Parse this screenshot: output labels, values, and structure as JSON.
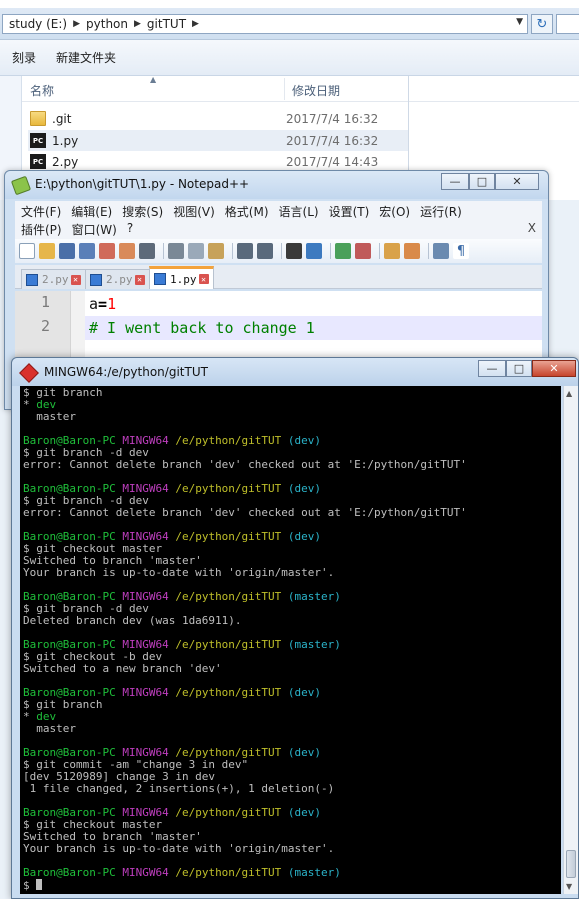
{
  "explorer": {
    "breadcrumbs": [
      "study (E:)",
      "python",
      "gitTUT"
    ],
    "commands": [
      "刻录",
      "新建文件夹"
    ],
    "columns": {
      "name": "名称",
      "date": "修改日期"
    },
    "files": [
      {
        "name": ".git",
        "date": "2017/7/4 16:32",
        "type": "folder"
      },
      {
        "name": "1.py",
        "date": "2017/7/4 16:32",
        "type": "py"
      },
      {
        "name": "2.py",
        "date": "2017/7/4 14:43",
        "type": "py"
      }
    ]
  },
  "notepad": {
    "title": "E:\\python\\gitTUT\\1.py - Notepad++",
    "menu_row1": [
      "文件(F)",
      "编辑(E)",
      "搜索(S)",
      "视图(V)",
      "格式(M)",
      "语言(L)",
      "设置(T)",
      "宏(O)",
      "运行(R)"
    ],
    "menu_row2": [
      "插件(P)",
      "窗口(W)",
      "?"
    ],
    "menu_close": "X",
    "tabs": [
      {
        "label": "2.py",
        "active": false
      },
      {
        "label": "2.py",
        "active": false
      },
      {
        "label": "1.py",
        "active": true
      }
    ],
    "line_numbers": [
      "1",
      "2"
    ],
    "code": {
      "line1": {
        "ident": "a",
        "op": "=",
        "num": "1"
      },
      "line2": {
        "comment": "# I went back to change 1"
      }
    }
  },
  "terminal": {
    "title": "MINGW64:/e/python/gitTUT",
    "colors": {
      "green": "#1fbf3a",
      "magenta": "#bf3fbf",
      "yellow": "#bfbf2a",
      "cyan": "#2bb3c9"
    },
    "lines": [
      [
        {
          "t": "$ git branch"
        }
      ],
      [
        {
          "t": "* "
        },
        {
          "t": "dev",
          "c": "green"
        }
      ],
      [
        {
          "t": "  master"
        }
      ],
      [
        {
          "t": ""
        }
      ],
      [
        {
          "t": "Baron@Baron-PC ",
          "c": "green"
        },
        {
          "t": "MINGW64 ",
          "c": "magenta"
        },
        {
          "t": "/e/python/gitTUT ",
          "c": "yellow"
        },
        {
          "t": "(dev)",
          "c": "cyan"
        }
      ],
      [
        {
          "t": "$ git branch -d dev"
        }
      ],
      [
        {
          "t": "error: Cannot delete branch 'dev' checked out at 'E:/python/gitTUT'"
        }
      ],
      [
        {
          "t": ""
        }
      ],
      [
        {
          "t": "Baron@Baron-PC ",
          "c": "green"
        },
        {
          "t": "MINGW64 ",
          "c": "magenta"
        },
        {
          "t": "/e/python/gitTUT ",
          "c": "yellow"
        },
        {
          "t": "(dev)",
          "c": "cyan"
        }
      ],
      [
        {
          "t": "$ git branch -d dev"
        }
      ],
      [
        {
          "t": "error: Cannot delete branch 'dev' checked out at 'E:/python/gitTUT'"
        }
      ],
      [
        {
          "t": ""
        }
      ],
      [
        {
          "t": "Baron@Baron-PC ",
          "c": "green"
        },
        {
          "t": "MINGW64 ",
          "c": "magenta"
        },
        {
          "t": "/e/python/gitTUT ",
          "c": "yellow"
        },
        {
          "t": "(dev)",
          "c": "cyan"
        }
      ],
      [
        {
          "t": "$ git checkout master"
        }
      ],
      [
        {
          "t": "Switched to branch 'master'"
        }
      ],
      [
        {
          "t": "Your branch is up-to-date with 'origin/master'."
        }
      ],
      [
        {
          "t": ""
        }
      ],
      [
        {
          "t": "Baron@Baron-PC ",
          "c": "green"
        },
        {
          "t": "MINGW64 ",
          "c": "magenta"
        },
        {
          "t": "/e/python/gitTUT ",
          "c": "yellow"
        },
        {
          "t": "(master)",
          "c": "cyan"
        }
      ],
      [
        {
          "t": "$ git branch -d dev"
        }
      ],
      [
        {
          "t": "Deleted branch dev (was 1da6911)."
        }
      ],
      [
        {
          "t": ""
        }
      ],
      [
        {
          "t": "Baron@Baron-PC ",
          "c": "green"
        },
        {
          "t": "MINGW64 ",
          "c": "magenta"
        },
        {
          "t": "/e/python/gitTUT ",
          "c": "yellow"
        },
        {
          "t": "(master)",
          "c": "cyan"
        }
      ],
      [
        {
          "t": "$ git checkout -b dev"
        }
      ],
      [
        {
          "t": "Switched to a new branch 'dev'"
        }
      ],
      [
        {
          "t": ""
        }
      ],
      [
        {
          "t": "Baron@Baron-PC ",
          "c": "green"
        },
        {
          "t": "MINGW64 ",
          "c": "magenta"
        },
        {
          "t": "/e/python/gitTUT ",
          "c": "yellow"
        },
        {
          "t": "(dev)",
          "c": "cyan"
        }
      ],
      [
        {
          "t": "$ git branch"
        }
      ],
      [
        {
          "t": "* "
        },
        {
          "t": "dev",
          "c": "green"
        }
      ],
      [
        {
          "t": "  master"
        }
      ],
      [
        {
          "t": ""
        }
      ],
      [
        {
          "t": "Baron@Baron-PC ",
          "c": "green"
        },
        {
          "t": "MINGW64 ",
          "c": "magenta"
        },
        {
          "t": "/e/python/gitTUT ",
          "c": "yellow"
        },
        {
          "t": "(dev)",
          "c": "cyan"
        }
      ],
      [
        {
          "t": "$ git commit -am \"change 3 in dev\""
        }
      ],
      [
        {
          "t": "[dev 5120989] change 3 in dev"
        }
      ],
      [
        {
          "t": " 1 file changed, 2 insertions(+), 1 deletion(-)"
        }
      ],
      [
        {
          "t": ""
        }
      ],
      [
        {
          "t": "Baron@Baron-PC ",
          "c": "green"
        },
        {
          "t": "MINGW64 ",
          "c": "magenta"
        },
        {
          "t": "/e/python/gitTUT ",
          "c": "yellow"
        },
        {
          "t": "(dev)",
          "c": "cyan"
        }
      ],
      [
        {
          "t": "$ git checkout master"
        }
      ],
      [
        {
          "t": "Switched to branch 'master'"
        }
      ],
      [
        {
          "t": "Your branch is up-to-date with 'origin/master'."
        }
      ],
      [
        {
          "t": ""
        }
      ],
      [
        {
          "t": "Baron@Baron-PC ",
          "c": "green"
        },
        {
          "t": "MINGW64 ",
          "c": "magenta"
        },
        {
          "t": "/e/python/gitTUT ",
          "c": "yellow"
        },
        {
          "t": "(master)",
          "c": "cyan"
        }
      ],
      [
        {
          "t": "$ "
        },
        {
          "cursor": true
        }
      ]
    ]
  }
}
